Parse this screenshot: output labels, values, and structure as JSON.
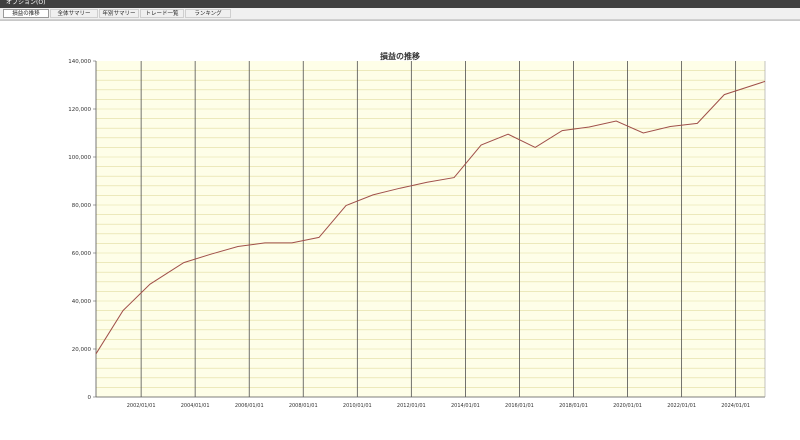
{
  "window": {
    "menu_label": "オプション(O)"
  },
  "tabs": [
    {
      "label": "損益の推移",
      "active": true
    },
    {
      "label": "全体サマリー",
      "active": false
    },
    {
      "label": "年別サマリー",
      "active": false
    },
    {
      "label": "トレード一覧",
      "active": false
    },
    {
      "label": "ランキング",
      "active": false
    }
  ],
  "colors": {
    "plot_bg": "#fefee8",
    "line": "#a0504a",
    "major_grid": "#505050",
    "minor_grid": "#e2dca0"
  },
  "chart_data": {
    "type": "line",
    "title": "損益の推移",
    "xlabel": "",
    "ylabel": "",
    "x_range": [
      "2000-05-01",
      "2025-02-01"
    ],
    "ylim": [
      0,
      140000
    ],
    "y_ticks": [
      0,
      20000,
      40000,
      60000,
      80000,
      100000,
      120000,
      140000
    ],
    "y_tick_labels": [
      "0",
      "20,000",
      "40,000",
      "60,000",
      "80,000",
      "100,000",
      "120,000",
      "140,000"
    ],
    "x_ticks": [
      "2002-01-01",
      "2004-01-01",
      "2006-01-01",
      "2008-01-01",
      "2010-01-01",
      "2012-01-01",
      "2014-01-01",
      "2016-01-01",
      "2018-01-01",
      "2020-01-01",
      "2022-01-01",
      "2024-01-01"
    ],
    "x_tick_labels": [
      "2002/01/01",
      "2004/01/01",
      "2006/01/01",
      "2008/01/01",
      "2010/01/01",
      "2012/01/01",
      "2014/01/01",
      "2016/01/01",
      "2018/01/01",
      "2020/01/01",
      "2022/01/01",
      "2024/01/01"
    ],
    "grid": true,
    "legend": "none",
    "series": [
      {
        "x": [
          "2000-05-01",
          "2001-05-01",
          "2002-05-01",
          "2003-08-01",
          "2004-08-01",
          "2005-08-01",
          "2006-08-01",
          "2007-08-01",
          "2008-08-01",
          "2009-08-01",
          "2010-08-01",
          "2011-08-01",
          "2012-08-01",
          "2013-08-01",
          "2014-08-01",
          "2015-08-01",
          "2016-08-01",
          "2017-08-01",
          "2018-08-01",
          "2019-08-01",
          "2020-08-01",
          "2021-08-01",
          "2022-08-01",
          "2023-08-01",
          "2025-02-01"
        ],
        "values": [
          18000,
          36000,
          47000,
          56000,
          59500,
          62700,
          64200,
          64200,
          66500,
          79800,
          84200,
          87000,
          89500,
          91400,
          105000,
          109500,
          104000,
          111000,
          112500,
          115000,
          110000,
          112700,
          114000,
          126000,
          131500
        ]
      }
    ]
  }
}
